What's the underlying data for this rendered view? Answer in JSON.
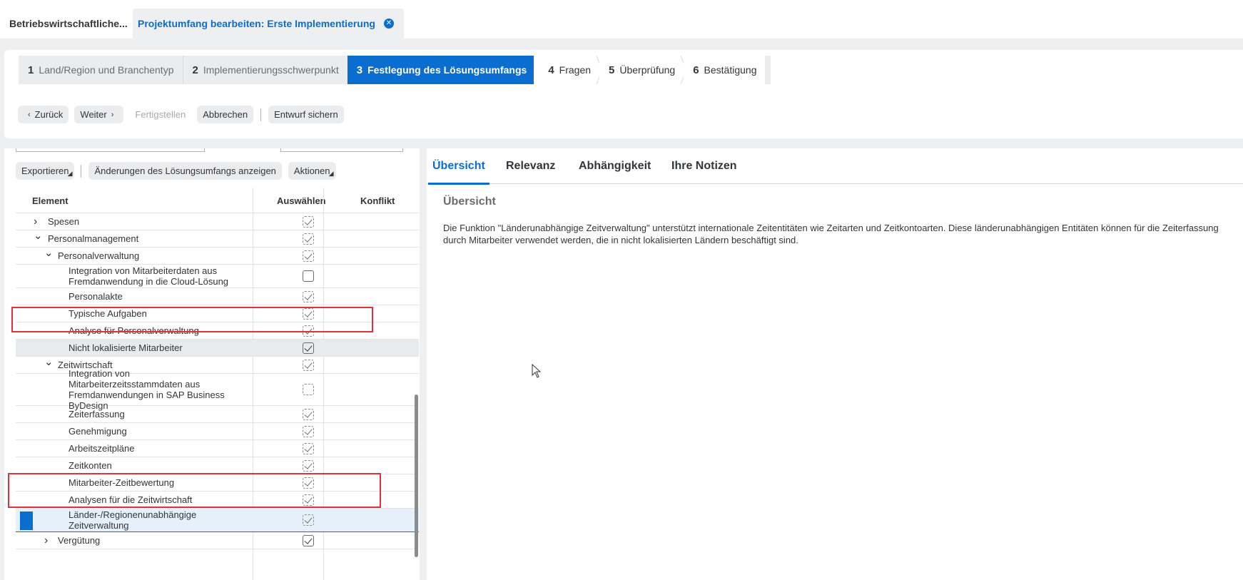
{
  "tabs": [
    {
      "label": "Betriebswirtschaftliche..."
    },
    {
      "label": "Projektumfang bearbeiten: Erste Implementierung",
      "close_icon": "close-circle-icon"
    }
  ],
  "wizard": {
    "steps": [
      {
        "num": "1",
        "label": "Land/Region und Branchentyp",
        "state": "done"
      },
      {
        "num": "2",
        "label": "Implementierungsschwerpunkt",
        "state": "done"
      },
      {
        "num": "3",
        "label": "Festlegung des Lösungsumfangs",
        "state": "active"
      },
      {
        "num": "4",
        "label": "Fragen",
        "state": "todo"
      },
      {
        "num": "5",
        "label": "Überprüfung",
        "state": "todo"
      },
      {
        "num": "6",
        "label": "Bestätigung",
        "state": "todo"
      }
    ],
    "buttons": {
      "back": "Zurück",
      "next": "Weiter",
      "finish": "Fertigstellen",
      "cancel": "Abbrechen",
      "save_draft": "Entwurf sichern"
    }
  },
  "left": {
    "toolbar": {
      "export": "Exportieren",
      "show_changes": "Änderungen des Lösungsumfangs anzeigen",
      "actions": "Aktionen"
    },
    "columns": {
      "element": "Element",
      "select": "Auswählen",
      "conflict": "Konflikt"
    },
    "rows": [
      {
        "label": "Spesen",
        "level": 1,
        "expander": "collapsed",
        "check": "checked-dashed"
      },
      {
        "label": "Personalmanagement",
        "level": 1,
        "expander": "expanded",
        "check": "checked-dashed"
      },
      {
        "label": "Personalverwaltung",
        "level": 2,
        "expander": "expanded",
        "check": "checked-dashed"
      },
      {
        "label": "Integration von Mitarbeiterdaten aus Fremdanwendung in die Cloud-Lösung",
        "level": 3,
        "check": "solid"
      },
      {
        "label": "Personalakte",
        "level": 3,
        "check": "checked-dashed"
      },
      {
        "label": "Typische Aufgaben",
        "level": 3,
        "check": "checked-dashed"
      },
      {
        "label": "Analyse für Personalverwaltung",
        "level": 3,
        "check": "checked-dashed"
      },
      {
        "label": "Nicht lokalisierte Mitarbeiter",
        "level": 3,
        "check": "checked-solid"
      },
      {
        "label": "Zeitwirtschaft",
        "level": 2,
        "expander": "expanded",
        "check": "checked-dashed"
      },
      {
        "label": "Integration von Mitarbeiterzeitsstammdaten aus Fremdanwendungen in SAP Business ByDesign",
        "level": 3,
        "check": "dashed"
      },
      {
        "label": "Zeiterfassung",
        "level": 3,
        "check": "checked-dashed"
      },
      {
        "label": "Genehmigung",
        "level": 3,
        "check": "checked-dashed"
      },
      {
        "label": "Arbeitszeitpläne",
        "level": 3,
        "check": "checked-dashed"
      },
      {
        "label": "Zeitkonten",
        "level": 3,
        "check": "checked-dashed"
      },
      {
        "label": "Mitarbeiter-Zeitbewertung",
        "level": 3,
        "check": "checked-dashed"
      },
      {
        "label": "Analysen für die Zeitwirtschaft",
        "level": 3,
        "check": "checked-dashed"
      },
      {
        "label": "Länder-/Regionenunabhängige Zeitverwaltung",
        "level": 3,
        "check": "checked-dashed"
      },
      {
        "label": "Vergütung",
        "level": 2,
        "expander": "collapsed",
        "check": "checked-solid"
      }
    ]
  },
  "right": {
    "tabs": [
      "Übersicht",
      "Relevanz",
      "Abhängigkeit",
      "Ihre Notizen"
    ],
    "section_title": "Übersicht",
    "description": "Die Funktion \"Länderunabhängige Zeitverwaltung\" unterstützt internationale Zeitentitäten wie Zeitarten und Zeitkontoarten. Diese länderunabhängigen Entitäten können für die Zeiterfassung durch Mitarbeiter verwendet werden, die in nicht lokalisierten Ländern beschäftigt sind."
  }
}
